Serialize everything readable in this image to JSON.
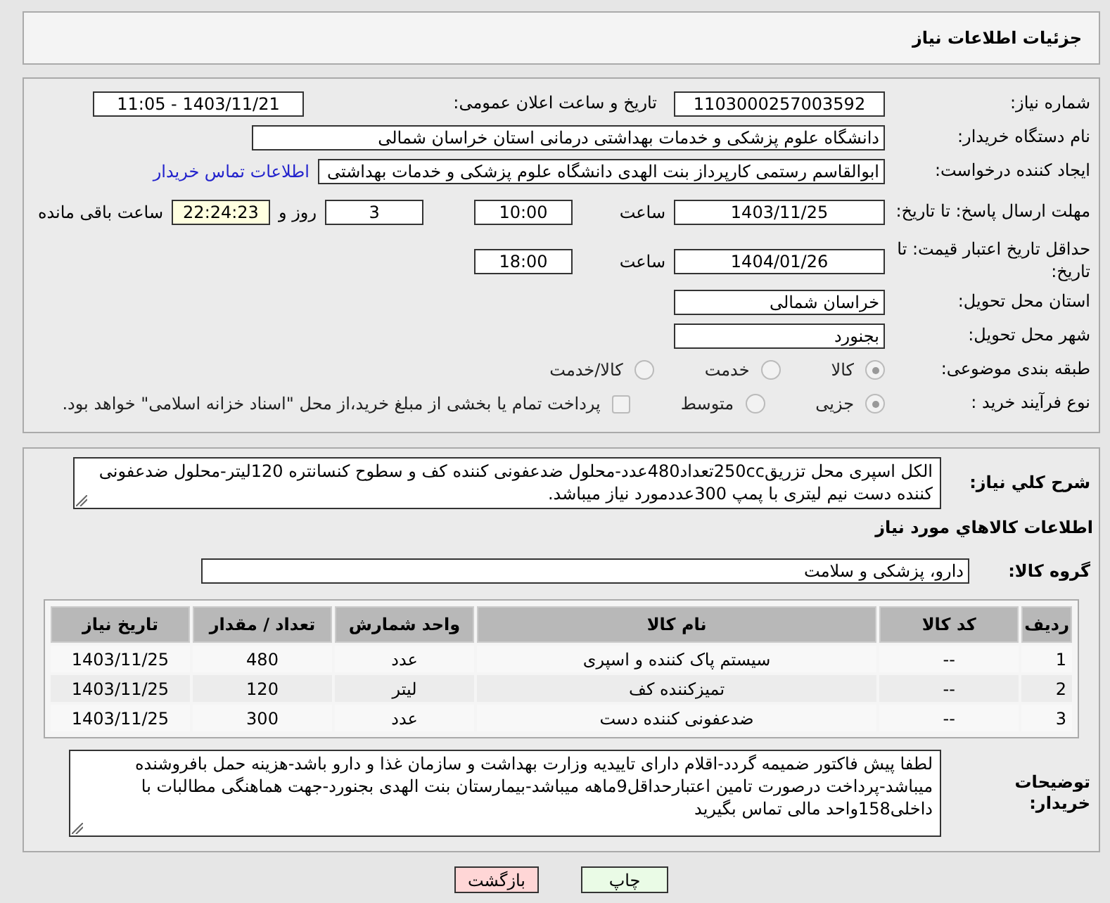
{
  "title": "جزئیات اطلاعات نیاز",
  "need_number": {
    "label": "شماره نیاز:",
    "value": "1103000257003592"
  },
  "announce": {
    "label": "تاریخ و ساعت اعلان عمومی:",
    "value": "1403/11/21 - 11:05"
  },
  "buyer": {
    "label": "نام دستگاه خریدار:",
    "value": "دانشگاه علوم پزشکی و خدمات بهداشتی درمانی استان خراسان شمالی"
  },
  "creator": {
    "label": "ایجاد کننده درخواست:",
    "value": "ابوالقاسم رستمی کارپرداز بنت الهدی دانشگاه علوم پزشکی و خدمات بهداشتی",
    "link": "اطلاعات تماس خریدار"
  },
  "deadline": {
    "label": "مهلت ارسال پاسخ: تا تاریخ:",
    "date": "1403/11/25",
    "time_label": "ساعت",
    "time": "10:00",
    "days": "3",
    "days_label": "روز و",
    "remaining": "22:24:23",
    "remaining_label": "ساعت باقی مانده"
  },
  "validity": {
    "label": "حداقل تاریخ اعتبار قیمت: تا تاریخ:",
    "date": "1404/01/26",
    "time_label": "ساعت",
    "time": "18:00"
  },
  "province": {
    "label": "استان محل تحویل:",
    "value": "خراسان شمالی"
  },
  "city": {
    "label": "شهر محل تحویل:",
    "value": "بجنورد"
  },
  "category": {
    "label": "طبقه بندی موضوعی:",
    "options": [
      {
        "label": "کالا",
        "selected": true
      },
      {
        "label": "خدمت",
        "selected": false
      },
      {
        "label": "کالا/خدمت",
        "selected": false
      }
    ]
  },
  "process": {
    "label": "نوع فرآیند خرید :",
    "options": [
      {
        "label": "جزیی",
        "selected": true
      },
      {
        "label": "متوسط",
        "selected": false
      }
    ],
    "treasury": {
      "checked": false,
      "label": "پرداخت تمام یا بخشی از مبلغ خرید،از محل \"اسناد خزانه اسلامی\" خواهد بود."
    }
  },
  "description": {
    "label": "شرح کلي نياز:",
    "value": "الکل اسپری محل تزریق250ccتعداد480عدد-محلول ضدعفونی کننده کف و سطوح کنسانتره 120لیتر-محلول ضدعفونی کننده دست نیم لیتری با پمپ 300عددمورد نیاز میباشد."
  },
  "goods_heading": "اطلاعات کالاهاي مورد نياز",
  "goods_group": {
    "label": "گروه کالا:",
    "value": "دارو، پزشکی و سلامت"
  },
  "table": {
    "columns": [
      "ردیف",
      "کد کالا",
      "نام کالا",
      "واحد شمارش",
      "تعداد / مقدار",
      "تاریخ نیاز"
    ],
    "rows": [
      [
        "1",
        "--",
        "سیستم پاک کننده و اسپری",
        "عدد",
        "480",
        "1403/11/25"
      ],
      [
        "2",
        "--",
        "تمیزکننده کف",
        "لیتر",
        "120",
        "1403/11/25"
      ],
      [
        "3",
        "--",
        "ضدعفونی کننده دست",
        "عدد",
        "300",
        "1403/11/25"
      ]
    ]
  },
  "buyer_notes": {
    "label": "توضیحات خریدار:",
    "value": "لطفا پیش فاکتور ضمیمه گردد-اقلام دارای تاییدیه وزارت بهداشت و سازمان غذا و دارو باشد-هزینه حمل بافروشنده میباشد-پرداخت درصورت تامین اعتبارحداقل9ماهه میباشد-بیمارستان بنت الهدی بجنورد-جهت هماهنگی مطالبات با داخلی158واحد مالی تماس بگیرید"
  },
  "buttons": [
    {
      "kind": "print",
      "label": "چاپ"
    },
    {
      "kind": "back",
      "label": "بازگشت"
    }
  ]
}
